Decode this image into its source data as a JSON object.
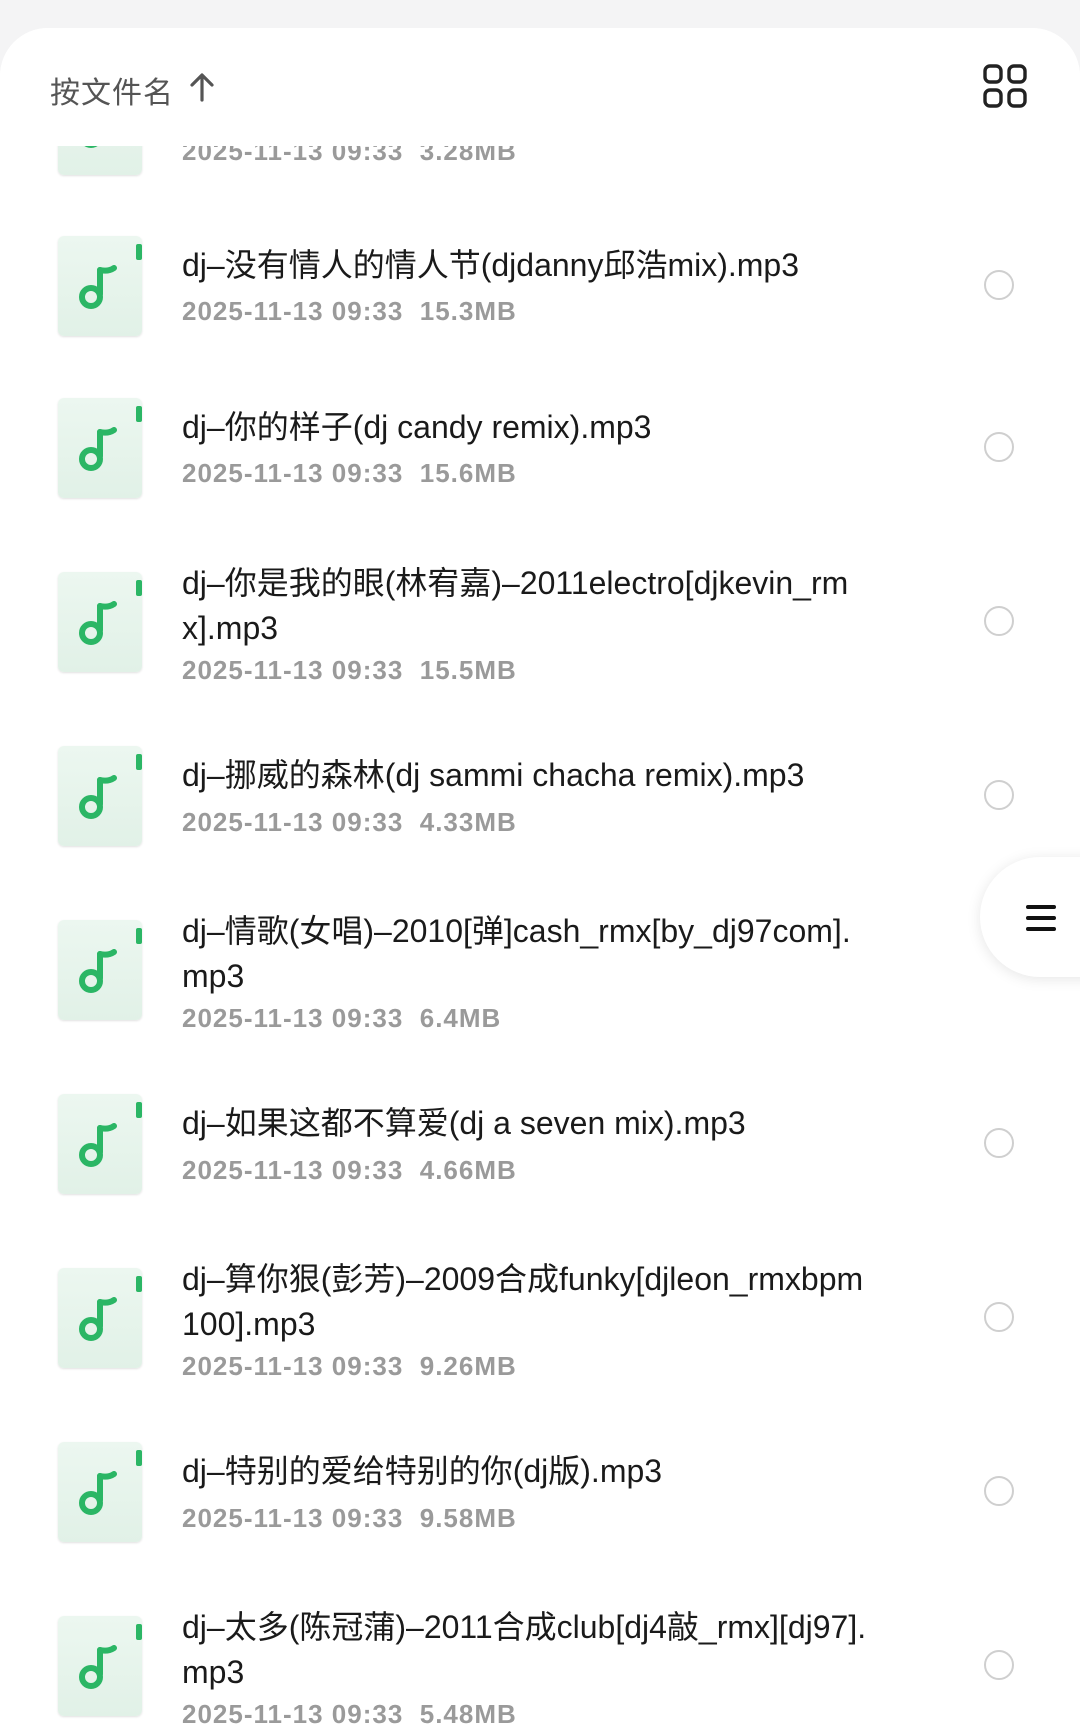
{
  "header": {
    "sort_label": "按文件名",
    "sort_icon": "arrow-up-icon",
    "view_toggle_icon": "grid-view-icon"
  },
  "files": [
    {
      "title": "",
      "date": "2025-11-13 09:33",
      "size": "3.28MB"
    },
    {
      "title": "dj–没有情人的情人节(djdanny邱浩mix).mp3",
      "date": "2025-11-13 09:33",
      "size": "15.3MB"
    },
    {
      "title": "dj–你的样子(dj candy remix).mp3",
      "date": "2025-11-13 09:33",
      "size": "15.6MB"
    },
    {
      "title": "dj–你是我的眼(林宥嘉)–2011electro[djkevin_rmx].mp3",
      "date": "2025-11-13 09:33",
      "size": "15.5MB"
    },
    {
      "title": "dj–挪威的森林(dj sammi chacha remix).mp3",
      "date": "2025-11-13 09:33",
      "size": "4.33MB"
    },
    {
      "title": "dj–情歌(女唱)–2010[弹]cash_rmx[by_dj97com].mp3",
      "date": "2025-11-13 09:33",
      "size": "6.4MB"
    },
    {
      "title": "dj–如果这都不算爱(dj a seven mix).mp3",
      "date": "2025-11-13 09:33",
      "size": "4.66MB"
    },
    {
      "title": "dj–算你狠(彭芳)–2009合成funky[djleon_rmxbpm100].mp3",
      "date": "2025-11-13 09:33",
      "size": "9.26MB"
    },
    {
      "title": "dj–特别的爱给特别的你(dj版).mp3",
      "date": "2025-11-13 09:33",
      "size": "9.58MB"
    },
    {
      "title": "dj–太多(陈冠蒲)–2011合成club[dj4敲_rmx][dj97].mp3",
      "date": "2025-11-13 09:33",
      "size": "5.48MB"
    }
  ],
  "floating_button_icon": "menu-icon",
  "colors": {
    "accent": "#2bb665",
    "meta": "#9a9a9a",
    "title": "#1a1a1a"
  }
}
